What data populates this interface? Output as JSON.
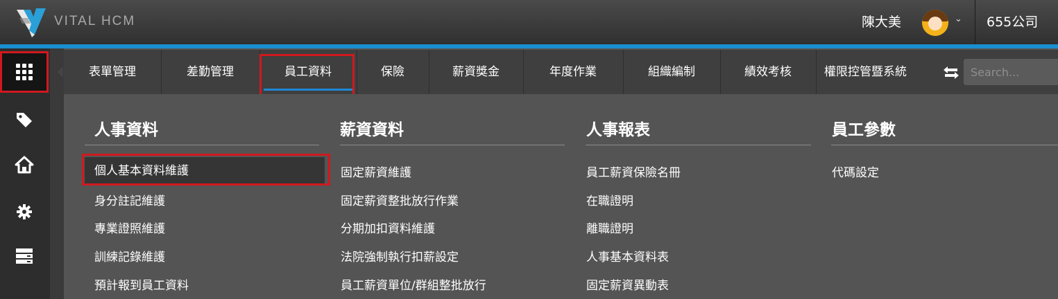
{
  "app": {
    "brand": "VITAL HCM"
  },
  "header": {
    "user_name": "陳大美",
    "company": "655公司",
    "avatar_icon": "user-avatar",
    "caret_icon": "chevron-down-icon"
  },
  "sidebar": {
    "items": [
      {
        "icon": "grid-apps-icon",
        "active": true
      },
      {
        "icon": "tag-icon",
        "active": false
      },
      {
        "icon": "home-icon",
        "active": false
      },
      {
        "icon": "gear-icon",
        "active": false
      },
      {
        "icon": "server-list-icon",
        "active": false
      }
    ]
  },
  "menu": {
    "tabs": [
      {
        "label": "表單管理",
        "active": false
      },
      {
        "label": "差勤管理",
        "active": false
      },
      {
        "label": "員工資料",
        "active": true
      },
      {
        "label": "保險",
        "active": false
      },
      {
        "label": "薪資獎金",
        "active": false
      },
      {
        "label": "年度作業",
        "active": false
      },
      {
        "label": "組織編制",
        "active": false
      },
      {
        "label": "績效考核",
        "active": false
      },
      {
        "label": "權限控管暨系統",
        "active": false
      }
    ],
    "search_placeholder": "Search..."
  },
  "sections": [
    {
      "title": "人事資料",
      "items": [
        "個人基本資料維護",
        "身分註記維護",
        "專業證照維護",
        "訓練記錄維護",
        "預計報到員工資料"
      ],
      "selected_index": 0
    },
    {
      "title": "薪資資料",
      "items": [
        "固定薪資維護",
        "固定薪資整批放行作業",
        "分期加扣資料維護",
        "法院強制執行扣薪設定",
        "員工薪資單位/群組整批放行"
      ]
    },
    {
      "title": "人事報表",
      "items": [
        "員工薪資保險名冊",
        "在職證明",
        "離職證明",
        "人事基本資料表",
        "固定薪資異動表"
      ]
    },
    {
      "title": "員工參數",
      "items": [
        "代碼設定"
      ]
    }
  ],
  "colors": {
    "accent": "#1a8fd0",
    "highlight": "#d0191f"
  }
}
